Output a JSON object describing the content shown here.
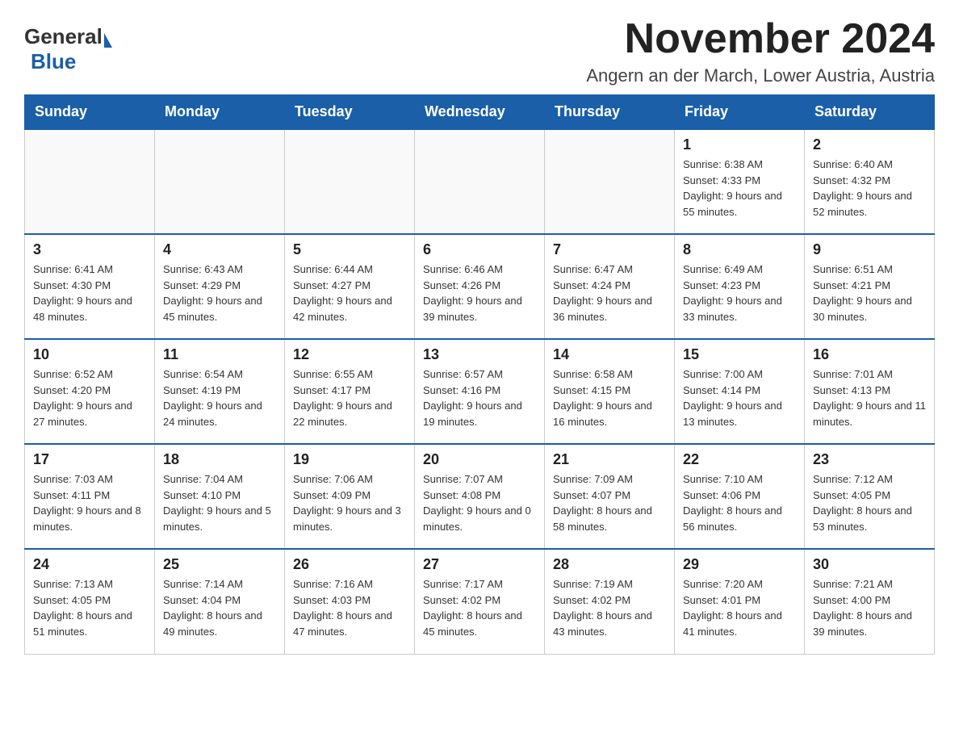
{
  "header": {
    "logo_general": "General",
    "logo_blue": "Blue",
    "month_title": "November 2024",
    "location": "Angern an der March, Lower Austria, Austria"
  },
  "days_of_week": [
    "Sunday",
    "Monday",
    "Tuesday",
    "Wednesday",
    "Thursday",
    "Friday",
    "Saturday"
  ],
  "weeks": [
    [
      {
        "day": "",
        "info": ""
      },
      {
        "day": "",
        "info": ""
      },
      {
        "day": "",
        "info": ""
      },
      {
        "day": "",
        "info": ""
      },
      {
        "day": "",
        "info": ""
      },
      {
        "day": "1",
        "info": "Sunrise: 6:38 AM\nSunset: 4:33 PM\nDaylight: 9 hours and 55 minutes."
      },
      {
        "day": "2",
        "info": "Sunrise: 6:40 AM\nSunset: 4:32 PM\nDaylight: 9 hours and 52 minutes."
      }
    ],
    [
      {
        "day": "3",
        "info": "Sunrise: 6:41 AM\nSunset: 4:30 PM\nDaylight: 9 hours and 48 minutes."
      },
      {
        "day": "4",
        "info": "Sunrise: 6:43 AM\nSunset: 4:29 PM\nDaylight: 9 hours and 45 minutes."
      },
      {
        "day": "5",
        "info": "Sunrise: 6:44 AM\nSunset: 4:27 PM\nDaylight: 9 hours and 42 minutes."
      },
      {
        "day": "6",
        "info": "Sunrise: 6:46 AM\nSunset: 4:26 PM\nDaylight: 9 hours and 39 minutes."
      },
      {
        "day": "7",
        "info": "Sunrise: 6:47 AM\nSunset: 4:24 PM\nDaylight: 9 hours and 36 minutes."
      },
      {
        "day": "8",
        "info": "Sunrise: 6:49 AM\nSunset: 4:23 PM\nDaylight: 9 hours and 33 minutes."
      },
      {
        "day": "9",
        "info": "Sunrise: 6:51 AM\nSunset: 4:21 PM\nDaylight: 9 hours and 30 minutes."
      }
    ],
    [
      {
        "day": "10",
        "info": "Sunrise: 6:52 AM\nSunset: 4:20 PM\nDaylight: 9 hours and 27 minutes."
      },
      {
        "day": "11",
        "info": "Sunrise: 6:54 AM\nSunset: 4:19 PM\nDaylight: 9 hours and 24 minutes."
      },
      {
        "day": "12",
        "info": "Sunrise: 6:55 AM\nSunset: 4:17 PM\nDaylight: 9 hours and 22 minutes."
      },
      {
        "day": "13",
        "info": "Sunrise: 6:57 AM\nSunset: 4:16 PM\nDaylight: 9 hours and 19 minutes."
      },
      {
        "day": "14",
        "info": "Sunrise: 6:58 AM\nSunset: 4:15 PM\nDaylight: 9 hours and 16 minutes."
      },
      {
        "day": "15",
        "info": "Sunrise: 7:00 AM\nSunset: 4:14 PM\nDaylight: 9 hours and 13 minutes."
      },
      {
        "day": "16",
        "info": "Sunrise: 7:01 AM\nSunset: 4:13 PM\nDaylight: 9 hours and 11 minutes."
      }
    ],
    [
      {
        "day": "17",
        "info": "Sunrise: 7:03 AM\nSunset: 4:11 PM\nDaylight: 9 hours and 8 minutes."
      },
      {
        "day": "18",
        "info": "Sunrise: 7:04 AM\nSunset: 4:10 PM\nDaylight: 9 hours and 5 minutes."
      },
      {
        "day": "19",
        "info": "Sunrise: 7:06 AM\nSunset: 4:09 PM\nDaylight: 9 hours and 3 minutes."
      },
      {
        "day": "20",
        "info": "Sunrise: 7:07 AM\nSunset: 4:08 PM\nDaylight: 9 hours and 0 minutes."
      },
      {
        "day": "21",
        "info": "Sunrise: 7:09 AM\nSunset: 4:07 PM\nDaylight: 8 hours and 58 minutes."
      },
      {
        "day": "22",
        "info": "Sunrise: 7:10 AM\nSunset: 4:06 PM\nDaylight: 8 hours and 56 minutes."
      },
      {
        "day": "23",
        "info": "Sunrise: 7:12 AM\nSunset: 4:05 PM\nDaylight: 8 hours and 53 minutes."
      }
    ],
    [
      {
        "day": "24",
        "info": "Sunrise: 7:13 AM\nSunset: 4:05 PM\nDaylight: 8 hours and 51 minutes."
      },
      {
        "day": "25",
        "info": "Sunrise: 7:14 AM\nSunset: 4:04 PM\nDaylight: 8 hours and 49 minutes."
      },
      {
        "day": "26",
        "info": "Sunrise: 7:16 AM\nSunset: 4:03 PM\nDaylight: 8 hours and 47 minutes."
      },
      {
        "day": "27",
        "info": "Sunrise: 7:17 AM\nSunset: 4:02 PM\nDaylight: 8 hours and 45 minutes."
      },
      {
        "day": "28",
        "info": "Sunrise: 7:19 AM\nSunset: 4:02 PM\nDaylight: 8 hours and 43 minutes."
      },
      {
        "day": "29",
        "info": "Sunrise: 7:20 AM\nSunset: 4:01 PM\nDaylight: 8 hours and 41 minutes."
      },
      {
        "day": "30",
        "info": "Sunrise: 7:21 AM\nSunset: 4:00 PM\nDaylight: 8 hours and 39 minutes."
      }
    ]
  ]
}
